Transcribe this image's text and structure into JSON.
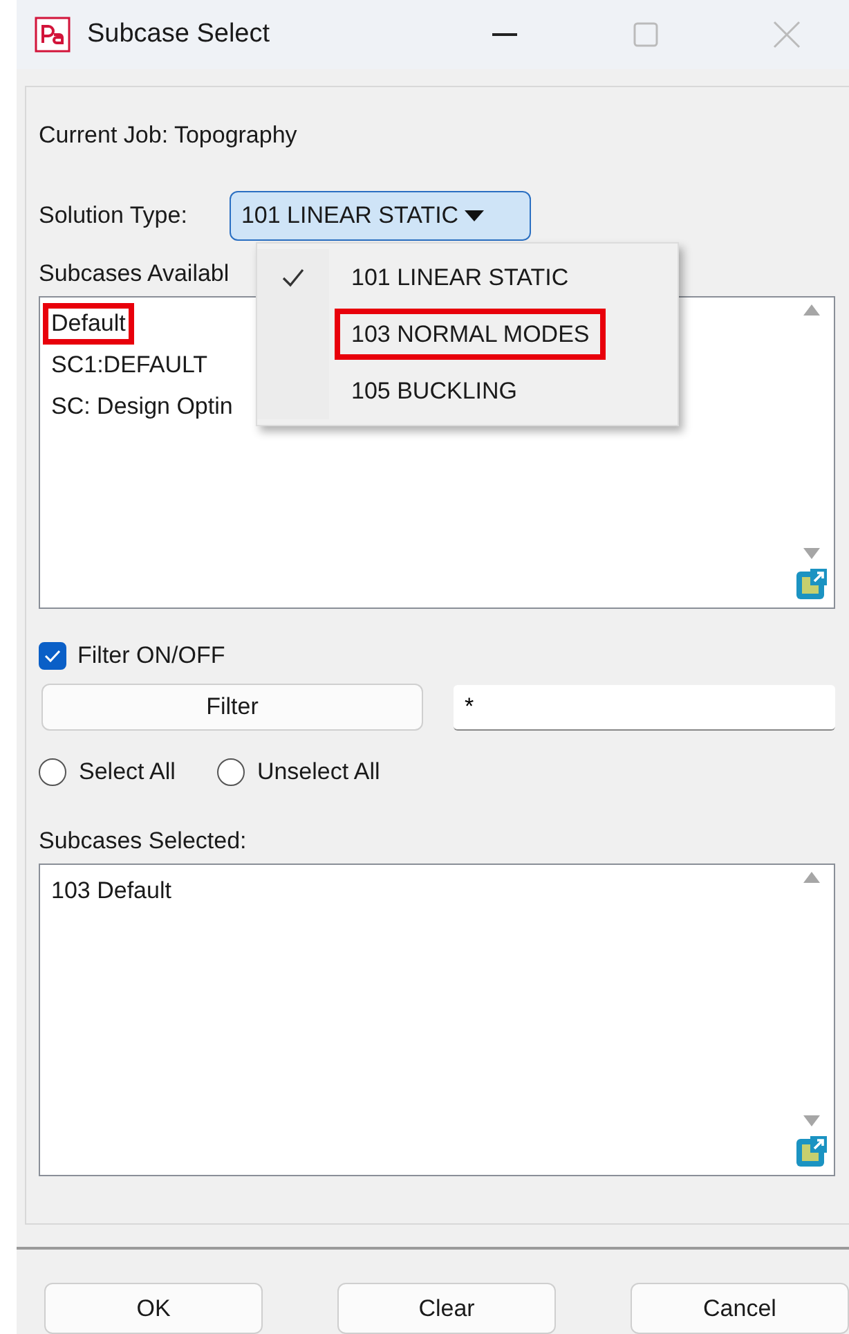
{
  "window": {
    "title": "Subcase Select"
  },
  "current_job": "Current Job: Topography",
  "solution_type": {
    "label": "Solution Type:",
    "value": "101  LINEAR STATIC",
    "expanded": true
  },
  "solution_menu": [
    {
      "label": "101  LINEAR STATIC",
      "selected": true,
      "highlighted": false
    },
    {
      "label": "103  NORMAL MODES",
      "selected": false,
      "highlighted": true
    },
    {
      "label": "105  BUCKLING",
      "selected": false,
      "highlighted": false
    }
  ],
  "subcases_available": {
    "label": "Subcases Availabl",
    "items": [
      {
        "label": "Default",
        "highlighted": true
      },
      {
        "label": "SC1:DEFAULT",
        "highlighted": false
      },
      {
        "label": "SC: Design Optin",
        "highlighted": false
      }
    ]
  },
  "filter_toggle": {
    "label": "Filter ON/OFF",
    "checked": true
  },
  "filter_button": "Filter",
  "filter_field": {
    "value": "*"
  },
  "radios": [
    {
      "label": "Select All",
      "selected": false
    },
    {
      "label": "Unselect All",
      "selected": false
    }
  ],
  "subcases_selected": {
    "label": "Subcases Selected:",
    "items": [
      {
        "label": "103  Default",
        "highlighted": false
      }
    ]
  },
  "buttons": [
    "OK",
    "Clear",
    "Cancel"
  ]
}
